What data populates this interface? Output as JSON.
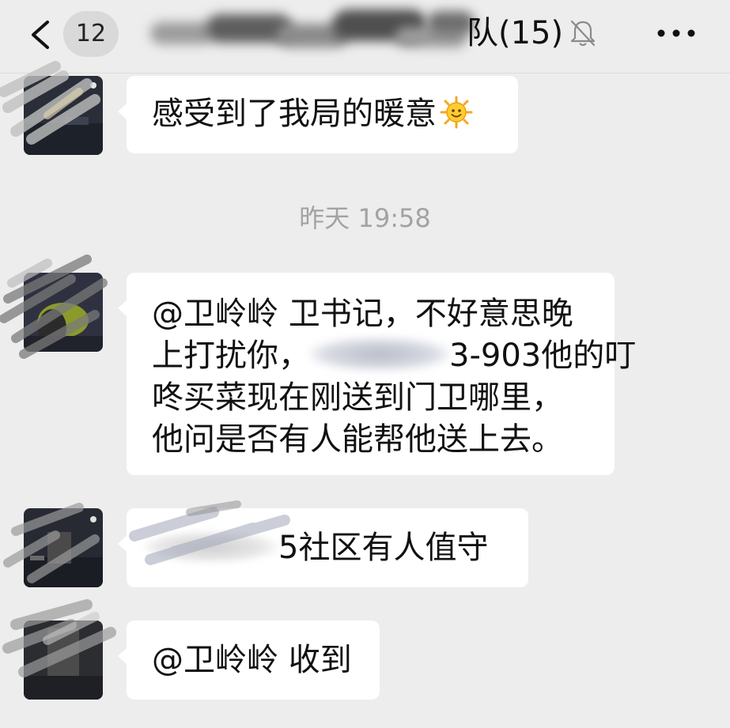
{
  "header": {
    "unread_count": "12",
    "title_visible": "队(15)",
    "icons": {
      "back": "chevron-left-icon",
      "mute": "bell-muted-icon",
      "more": "more-dots-icon"
    }
  },
  "messages": [
    {
      "text": "感受到了我局的暖意",
      "emoji": "sun-emoji-icon"
    },
    {
      "timestamp": "昨天 19:58"
    },
    {
      "lines": [
        "@卫岭岭 卫书记，不好意思晚",
        "上打扰你，",
        "3-903他的叮",
        "咚买菜现在刚送到门卫哪里，",
        "他问是否有人能帮他送上去。"
      ]
    },
    {
      "text": "5社区有人值守"
    },
    {
      "text": "@卫岭岭 收到"
    }
  ],
  "colors": {
    "background": "#ededed",
    "bubble": "#ffffff",
    "timestamp": "#a3a3a3"
  }
}
